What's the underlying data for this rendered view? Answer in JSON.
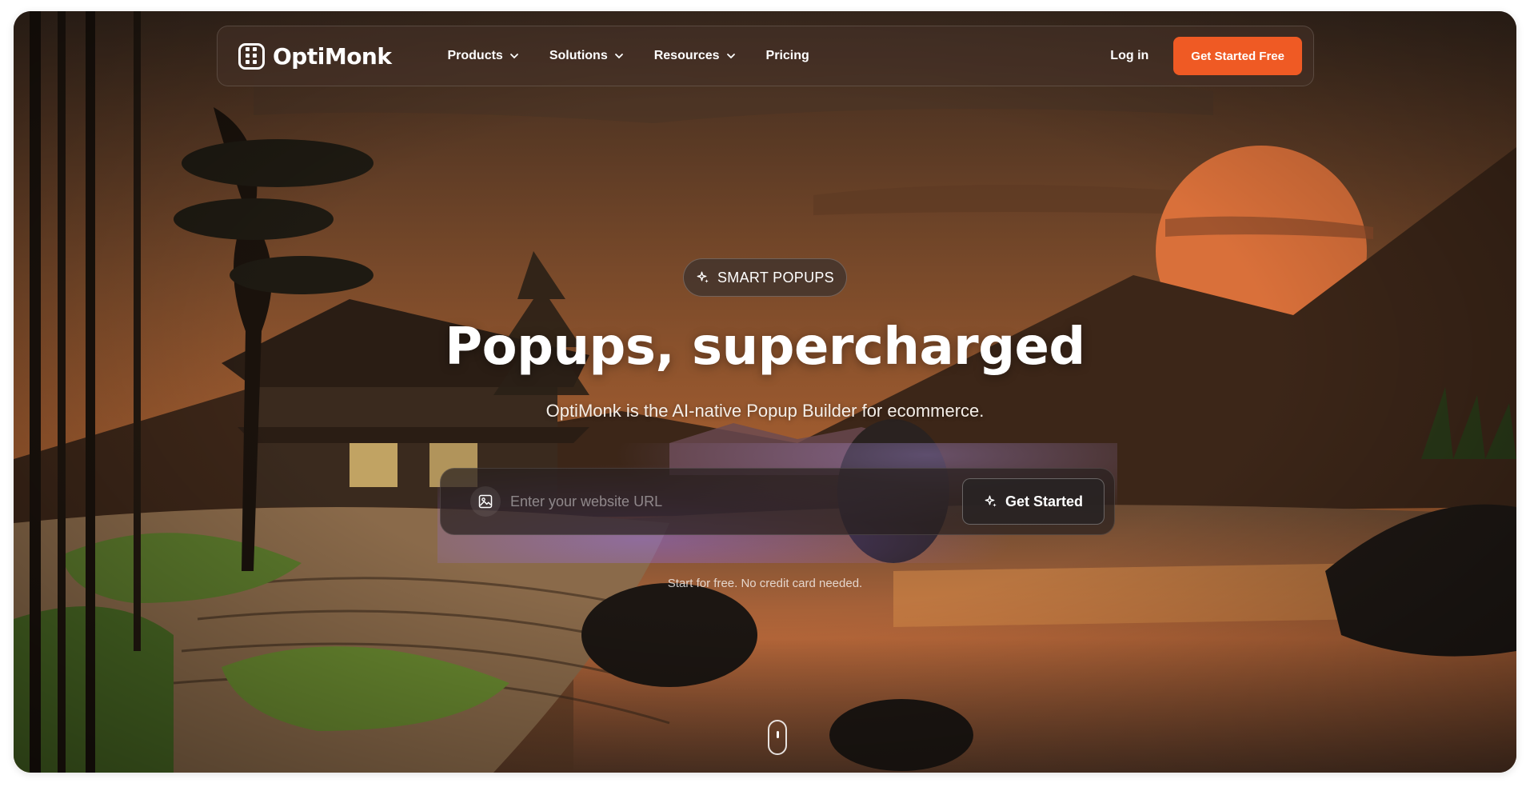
{
  "brand": {
    "name": "OptiMonk"
  },
  "nav": {
    "items": [
      {
        "label": "Products",
        "has_dropdown": true
      },
      {
        "label": "Solutions",
        "has_dropdown": true
      },
      {
        "label": "Resources",
        "has_dropdown": true
      },
      {
        "label": "Pricing",
        "has_dropdown": false
      }
    ],
    "login_label": "Log in",
    "cta_label": "Get Started Free"
  },
  "hero": {
    "badge_label": "SMART POPUPS",
    "headline": "Popups, supercharged",
    "subheadline": "OptiMonk is the AI-native Popup Builder for ecommerce.",
    "url_placeholder": "Enter your website URL",
    "submit_label": "Get Started",
    "fine_print": "Start for free. No credit card needed."
  },
  "colors": {
    "accent": "#ef5a24",
    "glow": "#9b7bff",
    "sun": "#e0733a"
  },
  "icons": [
    "logo-icon",
    "chevron-down-icon",
    "sparkle-icon",
    "image-icon",
    "scroll-mouse-icon"
  ]
}
